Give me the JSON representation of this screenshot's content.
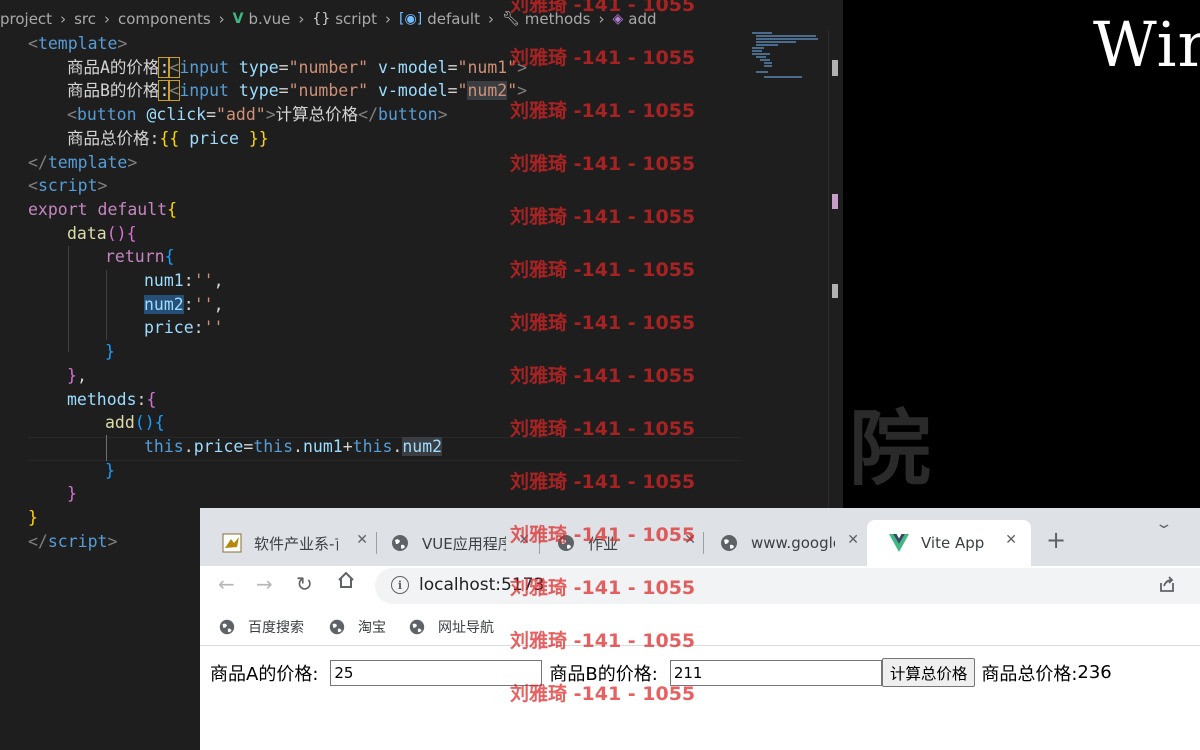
{
  "editor": {
    "breadcrumb": [
      {
        "text": "project",
        "icon": ""
      },
      {
        "text": "src",
        "icon": ""
      },
      {
        "text": "components",
        "icon": ""
      },
      {
        "text": "b.vue",
        "icon": "vue-icon"
      },
      {
        "text": "script",
        "icon": "braces-icon"
      },
      {
        "text": "default",
        "icon": "reference-icon"
      },
      {
        "text": "methods",
        "icon": "wrench-icon"
      },
      {
        "text": "add",
        "icon": "cube-icon"
      }
    ],
    "code": {
      "l1_tag": "template",
      "l2_label": "商品A的价格",
      "l2_colon": ":",
      "l2_input": "input",
      "l2_type_attr": "type",
      "l2_type_val": "\"number\"",
      "l2_model_attr": "v-model",
      "l2_model_val": "\"num1\"",
      "l3_label": "商品B的价格",
      "l3_colon": ":",
      "l3_model_val_open": "\"",
      "l3_model_val_hl": "num2",
      "l3_model_val_close": "\"",
      "l4_button": "button",
      "l4_click_attr": "@click",
      "l4_click_val": "\"add\"",
      "l4_text": "计算总价格",
      "l5_text": "商品总价格:",
      "l5_open": "{{",
      "l5_var": " price ",
      "l5_close": "}}",
      "l7_tag": "script",
      "l8_export": "export",
      "l8_default": "default",
      "l9_data": "data",
      "l10_return": "return",
      "l11_key": "num1",
      "l11_val": "''",
      "l12_key": "num2",
      "l12_val": "''",
      "l13_key": "price",
      "l13_val": "''",
      "l16_methods": "methods",
      "l17_add": "add",
      "l18_this1": "this",
      "l18_price": "price",
      "l18_this2": "this",
      "l18_num1": "num1",
      "l18_this3": "this",
      "l18_num2": "num2"
    }
  },
  "desktop": {
    "win_text": "Wir",
    "ghost_char": "院"
  },
  "browser": {
    "tabs": [
      {
        "title": "软件产业系-首",
        "icon": "bird-favicon-icon"
      },
      {
        "title": "VUE应用程序",
        "icon": "globe-icon"
      },
      {
        "title": "作业",
        "icon": "globe-icon"
      },
      {
        "title": "www.google.",
        "icon": "globe-icon"
      },
      {
        "title": "Vite App",
        "icon": "vue-icon"
      }
    ],
    "url": "localhost:5173",
    "bookmarks": [
      "百度搜索",
      "淘宝",
      "网址导航"
    ],
    "page": {
      "label_a": "商品A的价格:",
      "value_a": "25",
      "label_b": "商品B的价格:",
      "value_b": "211",
      "button": "计算总价格",
      "total_label": "商品总价格:",
      "total_value": "236"
    }
  },
  "watermark": {
    "text": "刘雅琦 -141 - 1055"
  },
  "colors": {
    "editor_bg": "#1e1e1e",
    "tag": "#569cd6",
    "attr": "#9cdcfe",
    "string": "#ce9178",
    "keyword": "#c586c0",
    "function": "#dcdcaa",
    "watermark": "#dc2626",
    "vue_green": "#41b883"
  }
}
